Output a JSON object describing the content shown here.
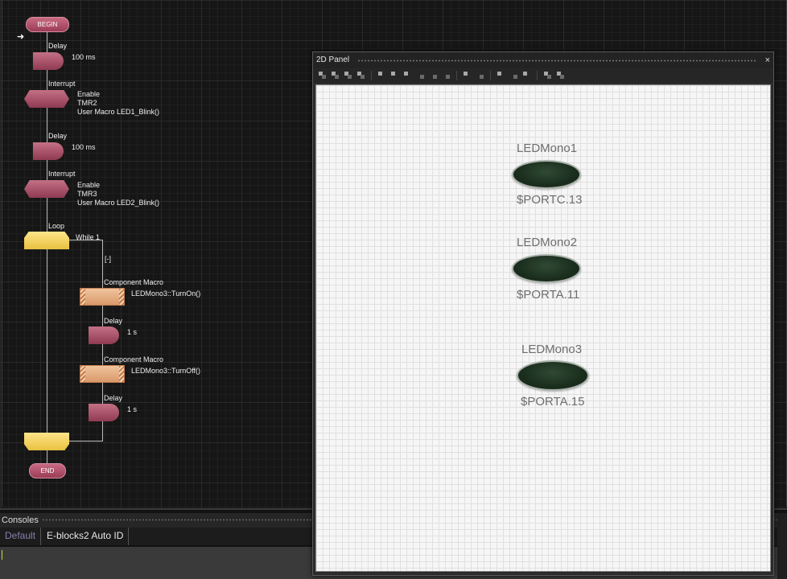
{
  "flowchart": {
    "begin_label": "BEGIN",
    "end_label": "END",
    "delay1": {
      "title": "Delay",
      "value": "100 ms"
    },
    "interrupt1": {
      "title": "Interrupt",
      "lines": [
        "Enable",
        "TMR2",
        "User Macro LED1_Blink()"
      ]
    },
    "delay2": {
      "title": "Delay",
      "value": "100 ms"
    },
    "interrupt2": {
      "title": "Interrupt",
      "lines": [
        "Enable",
        "TMR3",
        "User Macro LED2_Blink()"
      ]
    },
    "loop": {
      "title": "Loop",
      "condition": "While 1",
      "collapse": "[-]"
    },
    "macro1": {
      "title": "Component Macro",
      "call": "LEDMono3::TurnOn()"
    },
    "delay3": {
      "title": "Delay",
      "value": "1 s"
    },
    "macro2": {
      "title": "Component Macro",
      "call": "LEDMono3::TurnOff()"
    },
    "delay4": {
      "title": "Delay",
      "value": "1 s"
    }
  },
  "panel2d": {
    "title": "2D Panel",
    "close_icon": "×",
    "leds": [
      {
        "name": "LEDMono1",
        "port": "$PORTC.13"
      },
      {
        "name": "LEDMono2",
        "port": "$PORTA.11"
      },
      {
        "name": "LEDMono3",
        "port": "$PORTA.15"
      }
    ]
  },
  "consoles": {
    "title": "Consoles",
    "tabs": [
      "Default",
      "E-blocks2 Auto ID"
    ]
  },
  "colors": {
    "flow_terminal": "#b04e67",
    "loop_yellow": "#f5d55e",
    "macro_orange": "#e6ad7f",
    "led_off": "#1b2e1e"
  }
}
